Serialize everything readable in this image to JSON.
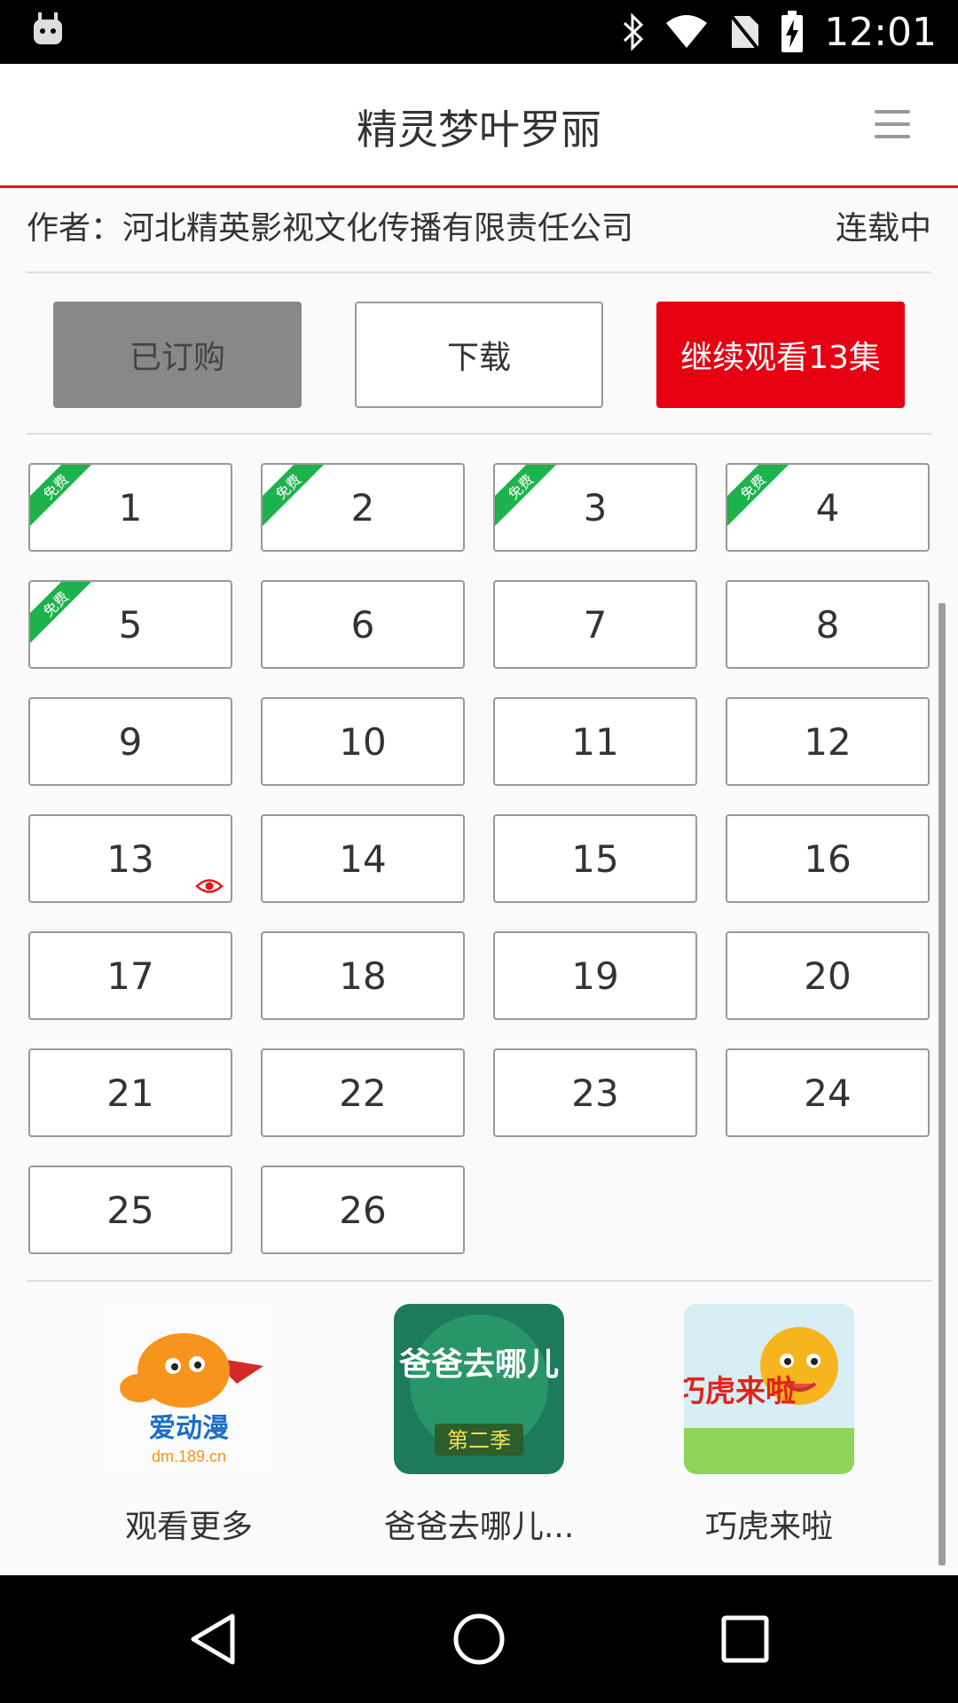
{
  "status_bar": {
    "time": "12:01",
    "icons": [
      "android-icon",
      "bluetooth-icon",
      "wifi-icon",
      "no-sim-icon",
      "battery-charging-icon"
    ]
  },
  "header": {
    "title": "精灵梦叶罗丽",
    "menu_icon": "hamburger-menu-icon",
    "accent_color": "#e5161e"
  },
  "info": {
    "author": "作者：河北精英影视文化传播有限责任公司",
    "status": "连载中"
  },
  "actions": {
    "subscribed_label": "已订购",
    "download_label": "下载",
    "continue_label": "继续观看13集"
  },
  "episodes": {
    "free_badge": "免费",
    "items": [
      {
        "label": "1",
        "free": true
      },
      {
        "label": "2",
        "free": true
      },
      {
        "label": "3",
        "free": true
      },
      {
        "label": "4",
        "free": true
      },
      {
        "label": "5",
        "free": true
      },
      {
        "label": "6"
      },
      {
        "label": "7"
      },
      {
        "label": "8"
      },
      {
        "label": "9"
      },
      {
        "label": "10"
      },
      {
        "label": "11"
      },
      {
        "label": "12"
      },
      {
        "label": "13",
        "watching": true
      },
      {
        "label": "14"
      },
      {
        "label": "15"
      },
      {
        "label": "16"
      },
      {
        "label": "17"
      },
      {
        "label": "18"
      },
      {
        "label": "19"
      },
      {
        "label": "20"
      },
      {
        "label": "21"
      },
      {
        "label": "22"
      },
      {
        "label": "23"
      },
      {
        "label": "24"
      },
      {
        "label": "25"
      },
      {
        "label": "26"
      }
    ]
  },
  "recommendations": [
    {
      "label": "观看更多",
      "logo_text": "爱动漫",
      "logo_sub": "dm.189.cn"
    },
    {
      "label": "爸爸去哪儿...",
      "logo_text": "爸爸去哪儿",
      "logo_sub": "第二季"
    },
    {
      "label": "巧虎来啦",
      "logo_text": "巧虎来啦"
    }
  ],
  "nav_bar": {
    "icons": [
      "back-icon",
      "home-icon",
      "recents-icon"
    ]
  }
}
